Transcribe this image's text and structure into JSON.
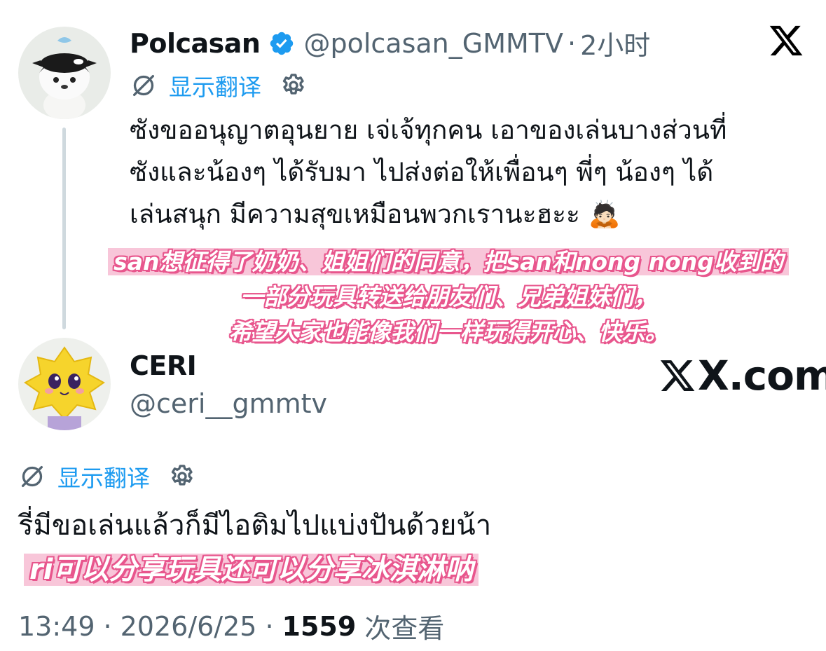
{
  "window": {
    "source_label": "X.com"
  },
  "post_original": {
    "author_name": "Polcasan",
    "author_handle": "@polcasan_GMMTV",
    "separator": "·",
    "time_ago": "2小时",
    "translate_label": "显示翻译",
    "text": "ซังขออนุญาตอุนยาย เจ่เจ้ทุกคน เอาของเล่นบางส่วนที่\nซังและน้องๆ ได้รับมา ไปส่งต่อให้เพื่อนๆ พี่ๆ น้องๆ ได้\nเล่นสนุก มีความสุขเหมือนพวกเรานะฮะะ 🙇🏻",
    "subtitle_lines": [
      "san想征得了奶奶、姐姐们的同意，把san和nong nong收到的",
      "一部分玩具转送给朋友们、兄弟姐妹们，",
      "希望大家也能像我们一样玩得开心、快乐。"
    ]
  },
  "post_reply": {
    "author_name": "CERI",
    "author_handle": "@ceri__gmmtv",
    "translate_label": "显示翻译",
    "text": "รี่มีขอเล่นแล้วก็มีไอติมไปแบ่งปันด้วยน้า",
    "subtitle": "ri可以分享玩具还可以分享冰淇淋呐",
    "time": "13:49",
    "date": "2026/6/25",
    "separator": "·",
    "views_count": "1559",
    "views_label": "次查看"
  },
  "icons": {
    "x_logo": "x-logo-icon",
    "verified": "verified-badge-icon",
    "translate": "translate-icon",
    "settings": "gear-icon"
  },
  "colors": {
    "link": "#1d9bf0",
    "muted": "#536471",
    "text": "#0f1419",
    "subtitle_outline": "#e8568d",
    "subtitle_highlight": "#f8c6d9"
  }
}
